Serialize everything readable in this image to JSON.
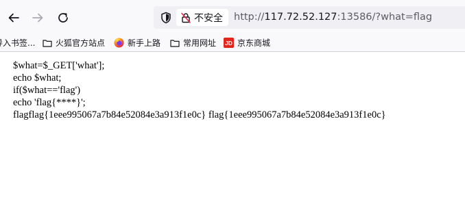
{
  "toolbar": {
    "back_icon": "back-arrow-icon",
    "forward_icon": "forward-arrow-icon",
    "reload_icon": "reload-icon"
  },
  "urlbar": {
    "security_label": "不安全",
    "url_scheme": "http://",
    "url_host": "117.72.52.127",
    "url_rest": ":13586/?what=flag"
  },
  "bookmarks": [
    {
      "label": "导入书签...",
      "icon": "import-icon"
    },
    {
      "label": "火狐官方站点",
      "icon": "folder-icon"
    },
    {
      "label": "新手上路",
      "icon": "firefox-icon"
    },
    {
      "label": "常用网址",
      "icon": "folder-icon"
    },
    {
      "label": "京东商城",
      "icon": "jd-icon"
    }
  ],
  "page": {
    "lines": [
      "$what=$_GET['what'];",
      "echo $what;",
      "if($what=='flag')",
      "echo 'flag{****}';",
      "flagflag{1eee995067a7b84e52084e3a913f1e0c} flag{1eee995067a7b84e52084e3a913f1e0c}"
    ]
  },
  "colors": {
    "chrome_bg": "#f9f9fb",
    "urlbar_bg": "#f0f0f4",
    "jd_red": "#e1251b"
  }
}
